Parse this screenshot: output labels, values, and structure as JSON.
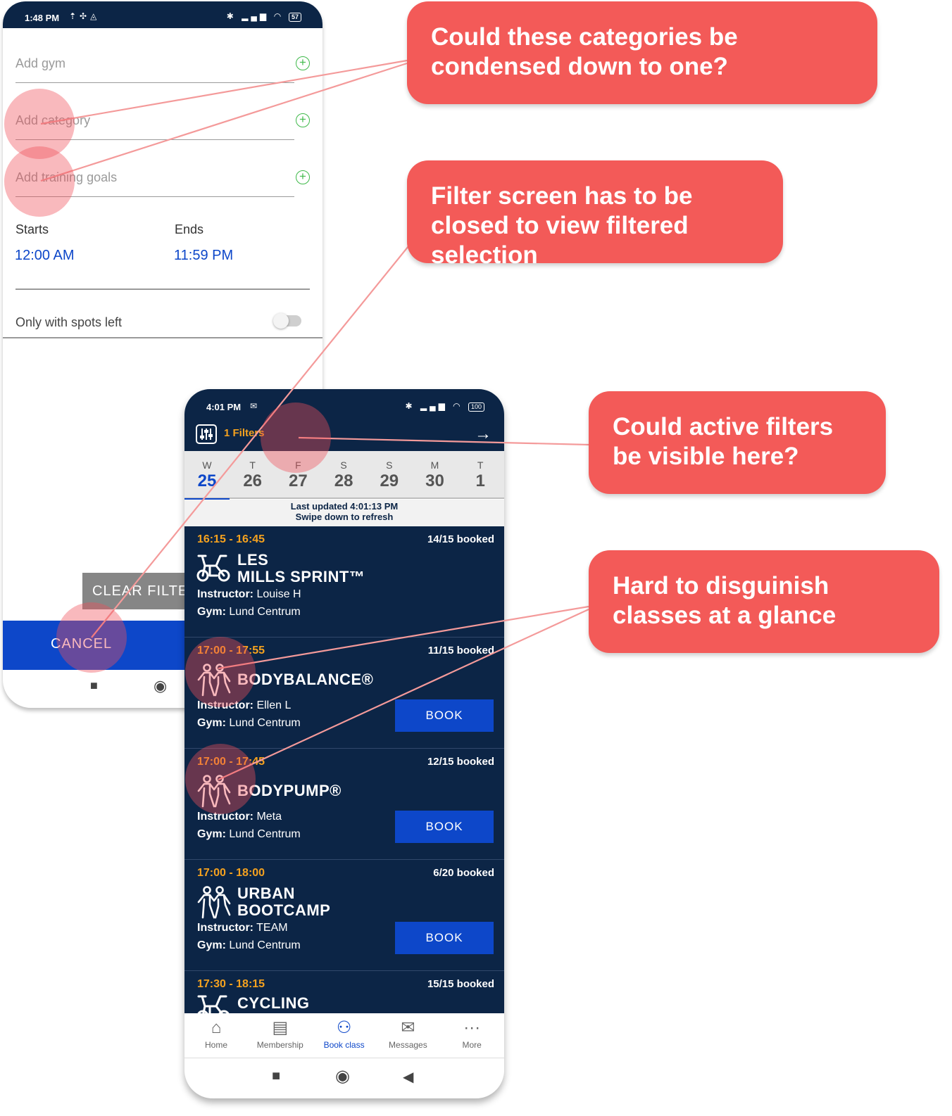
{
  "filter_screen": {
    "status": {
      "time": "1:48 PM",
      "battery": "57"
    },
    "fields": [
      {
        "placeholder": "Add gym"
      },
      {
        "placeholder": "Add category"
      },
      {
        "placeholder": "Add training goals"
      }
    ],
    "starts_label": "Starts",
    "ends_label": "Ends",
    "starts_value": "12:00 AM",
    "ends_value": "11:59 PM",
    "spots_label": "Only with spots left",
    "spots_toggle_on": false,
    "clear_button": "CLEAR FILTE",
    "cancel_button": "CANCEL"
  },
  "class_screen": {
    "status": {
      "time": "4:01 PM",
      "battery": "100"
    },
    "filters_label": "1 Filters",
    "days": [
      {
        "name": "W",
        "date": "25",
        "selected": true
      },
      {
        "name": "T",
        "date": "26"
      },
      {
        "name": "F",
        "date": "27"
      },
      {
        "name": "S",
        "date": "28"
      },
      {
        "name": "S",
        "date": "29"
      },
      {
        "name": "M",
        "date": "30"
      },
      {
        "name": "T",
        "date": "1"
      }
    ],
    "updated_line1": "Last updated 4:01:13 PM",
    "updated_line2": "Swipe down to refresh",
    "instructor_label": "Instructor:",
    "gym_label": "Gym:",
    "classes": [
      {
        "time": "16:15 - 16:45",
        "booked": "14/15 booked",
        "name": "LES\nMILLS SPRINT™",
        "instructor": "Louise H",
        "gym": "Lund Centrum",
        "book": ""
      },
      {
        "time": "17:00 - 17:55",
        "booked": "11/15 booked",
        "name": "BODYBALANCE®",
        "instructor": "Ellen L",
        "gym": "Lund Centrum",
        "book": "BOOK"
      },
      {
        "time": "17:00 - 17:45",
        "booked": "12/15 booked",
        "name": "BODYPUMP®",
        "instructor": "Meta",
        "gym": "Lund Centrum",
        "book": "BOOK"
      },
      {
        "time": "17:00 - 18:00",
        "booked": "6/20 booked",
        "name": "URBAN\nBOOTCAMP",
        "instructor": "TEAM",
        "gym": "Lund Centrum",
        "book": "BOOK"
      },
      {
        "time": "17:30 - 18:15",
        "booked": "15/15 booked",
        "name": "CYCLING",
        "instructor": "",
        "gym": "",
        "book": ""
      }
    ],
    "tabs": [
      {
        "label": "Home",
        "icon": "home-icon"
      },
      {
        "label": "Membership",
        "icon": "membership-card-icon"
      },
      {
        "label": "Book class",
        "icon": "people-icon",
        "active": true
      },
      {
        "label": "Messages",
        "icon": "envelope-icon"
      },
      {
        "label": "More",
        "icon": "more-dots-icon"
      }
    ]
  },
  "callouts": [
    {
      "text": "Could these categories be condensed down to one?"
    },
    {
      "text": "Filter screen has to be closed to view filtered selection"
    },
    {
      "text": "Could active filters be visible here?"
    },
    {
      "text": "Hard to disguinish classes at a glance"
    }
  ],
  "colors": {
    "navy": "#0c2546",
    "accent_blue": "#0d47c9",
    "orange": "#f5a21f",
    "callout_red": "#f35a58",
    "add_green": "#3fb94a"
  }
}
